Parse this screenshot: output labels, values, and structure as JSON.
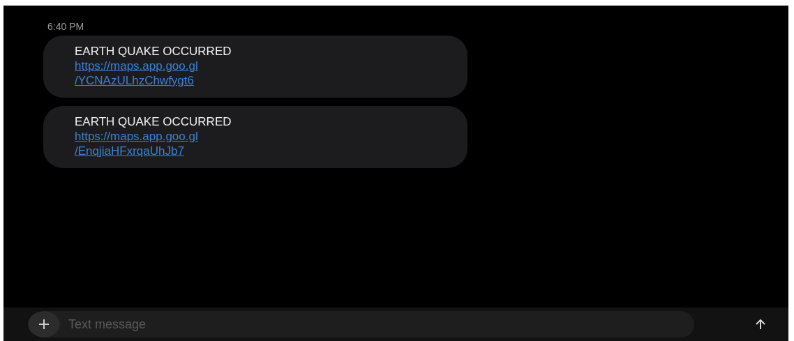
{
  "timestamp": "6:40 PM",
  "messages": [
    {
      "text": "EARTH QUAKE OCCURRED",
      "link_lines": [
        "https://maps.app.goo.gl",
        "/YCNAzULhzChwfygt6"
      ]
    },
    {
      "text": "EARTH QUAKE OCCURRED",
      "link_lines": [
        "https://maps.app.goo.gl",
        "/EnqjiaHFxrqaUhJb7"
      ]
    }
  ],
  "composer": {
    "placeholder": "Text message"
  }
}
